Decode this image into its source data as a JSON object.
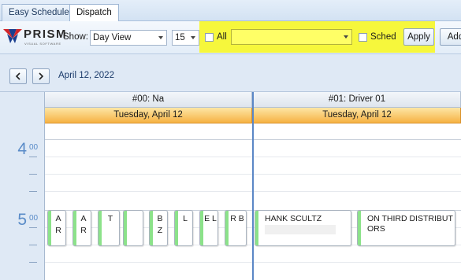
{
  "tabs": [
    {
      "label": "Easy Schedule",
      "active": false
    },
    {
      "label": "Dispatch",
      "active": true
    }
  ],
  "logo": {
    "brand": "PRISM",
    "tagline": "VISUAL SOFTWARE"
  },
  "toolbar": {
    "show_label": "Show:",
    "view_value": "Day View",
    "interval_value": "15",
    "all_label": "All",
    "all_checked": false,
    "filter_value": "",
    "sched_label": "Sched",
    "sched_checked": false,
    "apply_label": "Apply",
    "add_label": "Add",
    "highlight_color": "#f6f73c"
  },
  "date_nav": {
    "prev_icon": "chevron-left-icon",
    "next_icon": "chevron-right-icon",
    "current_date": "April 12, 2022"
  },
  "scheduler": {
    "columns": [
      {
        "resource": "#00: Na",
        "day": "Tuesday, April 12"
      },
      {
        "resource": "#01: Driver 01",
        "day": "Tuesday, April 12"
      }
    ],
    "hours": [
      {
        "hour": "4",
        "minutes": "00"
      },
      {
        "hour": "5",
        "minutes": "00"
      }
    ],
    "appointments_col0": [
      {
        "text": "A R"
      },
      {
        "text": "A R"
      },
      {
        "text": "T"
      },
      {
        "text": ""
      },
      {
        "text": "B Z"
      },
      {
        "text": "L"
      },
      {
        "text": "E L"
      },
      {
        "text": "R B"
      }
    ],
    "appointments_col1": [
      {
        "text": "HANK SCULTZ"
      },
      {
        "text": "ON THIRD DISTRIBUTORS"
      }
    ],
    "status_color": "#8ce28a",
    "current_column_line_color": "#5b87c6"
  }
}
